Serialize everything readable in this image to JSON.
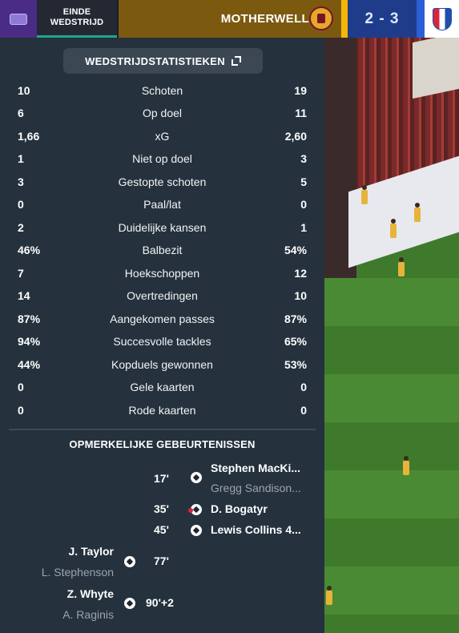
{
  "header": {
    "status_line1": "EINDE",
    "status_line2": "WEDSTRIJD",
    "home_team": "MOTHERWELL",
    "score": "2 - 3"
  },
  "stats": {
    "title": "WEDSTRIJDSTATISTIEKEN",
    "rows": [
      {
        "left": "10",
        "label": "Schoten",
        "right": "19"
      },
      {
        "left": "6",
        "label": "Op doel",
        "right": "11"
      },
      {
        "left": "1,66",
        "label": "xG",
        "right": "2,60"
      },
      {
        "left": "1",
        "label": "Niet op doel",
        "right": "3"
      },
      {
        "left": "3",
        "label": "Gestopte schoten",
        "right": "5"
      },
      {
        "left": "0",
        "label": "Paal/lat",
        "right": "0"
      },
      {
        "left": "2",
        "label": "Duidelijke kansen",
        "right": "1"
      },
      {
        "left": "46%",
        "label": "Balbezit",
        "right": "54%"
      },
      {
        "left": "7",
        "label": "Hoekschoppen",
        "right": "12"
      },
      {
        "left": "14",
        "label": "Overtredingen",
        "right": "10"
      },
      {
        "left": "87%",
        "label": "Aangekomen passes",
        "right": "87%"
      },
      {
        "left": "94%",
        "label": "Succesvolle tackles",
        "right": "65%"
      },
      {
        "left": "44%",
        "label": "Kopduels gewonnen",
        "right": "53%"
      },
      {
        "left": "0",
        "label": "Gele kaarten",
        "right": "0"
      },
      {
        "left": "0",
        "label": "Rode kaarten",
        "right": "0"
      }
    ]
  },
  "events": {
    "title": "OPMERKELIJKE GEBEURTENISSEN",
    "items": [
      {
        "minute": "17'",
        "scorer": "Stephen MacKi...",
        "assist": "Gregg Sandison...",
        "icon": "goal-ball-icon"
      },
      {
        "minute": "35'",
        "scorer": "D. Bogatyr",
        "assist": "",
        "icon": "own-goal-ball-icon"
      },
      {
        "minute": "45'",
        "scorer": "Lewis Collins 4...",
        "assist": "",
        "icon": "goal-ball-icon"
      },
      {
        "minute": "77'",
        "scorer": "J. Taylor",
        "assist": "L. Stephenson",
        "icon": "goal-ball-icon"
      },
      {
        "minute": "90'+2",
        "scorer": "Z. Whyte",
        "assist": "A. Raginis",
        "icon": "goal-ball-icon"
      }
    ]
  },
  "colors": {
    "panel": "#25323d",
    "home_bar": "#7b5a10",
    "accent_yellow": "#f2b705",
    "score_bg": "#1f3c8a",
    "status_underline": "#21a58a"
  }
}
